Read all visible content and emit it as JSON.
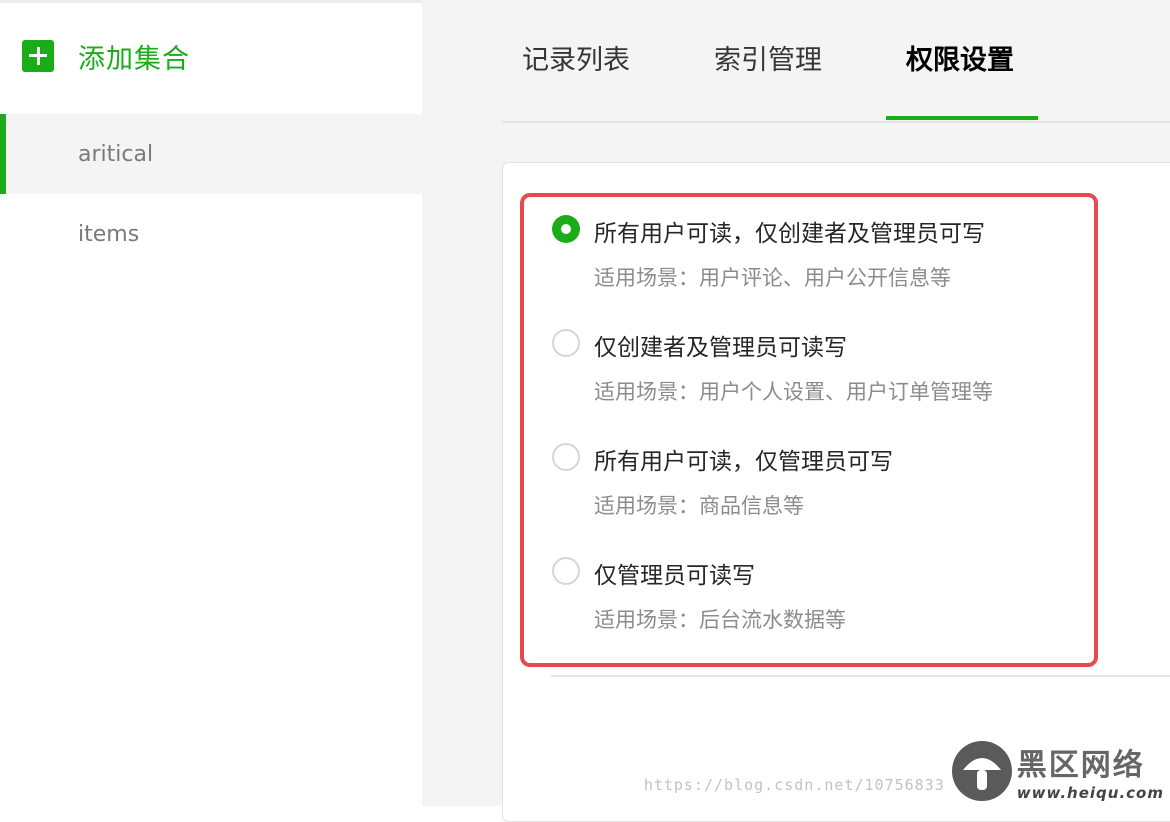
{
  "sidebar": {
    "add_label": "添加集合",
    "items": [
      {
        "label": "aritical"
      },
      {
        "label": "items"
      }
    ]
  },
  "tabs": [
    {
      "label": "记录列表"
    },
    {
      "label": "索引管理"
    },
    {
      "label": "权限设置"
    }
  ],
  "active_tab": "权限设置",
  "permissions": {
    "selected_index": 0,
    "options": [
      {
        "title": "所有用户可读，仅创建者及管理员可写",
        "desc": "适用场景：用户评论、用户公开信息等"
      },
      {
        "title": "仅创建者及管理员可读写",
        "desc": "适用场景：用户个人设置、用户订单管理等"
      },
      {
        "title": "所有用户可读，仅管理员可写",
        "desc": "适用场景：商品信息等"
      },
      {
        "title": "仅管理员可读写",
        "desc": "适用场景：后台流水数据等"
      }
    ]
  },
  "watermark": {
    "url": "https://blog.csdn.net/10756833",
    "brand": "黑区网络",
    "domain": "www.heiqu.com"
  },
  "colors": {
    "accent": "#1aad19",
    "highlight": "#e64a4f",
    "sidebar_active_bg": "#f4f4f4",
    "main_bg": "#f4f4f4"
  },
  "icons": {
    "add": "plus-icon",
    "radio_checked": "radio-checked-icon",
    "radio_unchecked": "radio-unchecked-icon",
    "watermark_logo": "mushroom-logo-icon"
  }
}
